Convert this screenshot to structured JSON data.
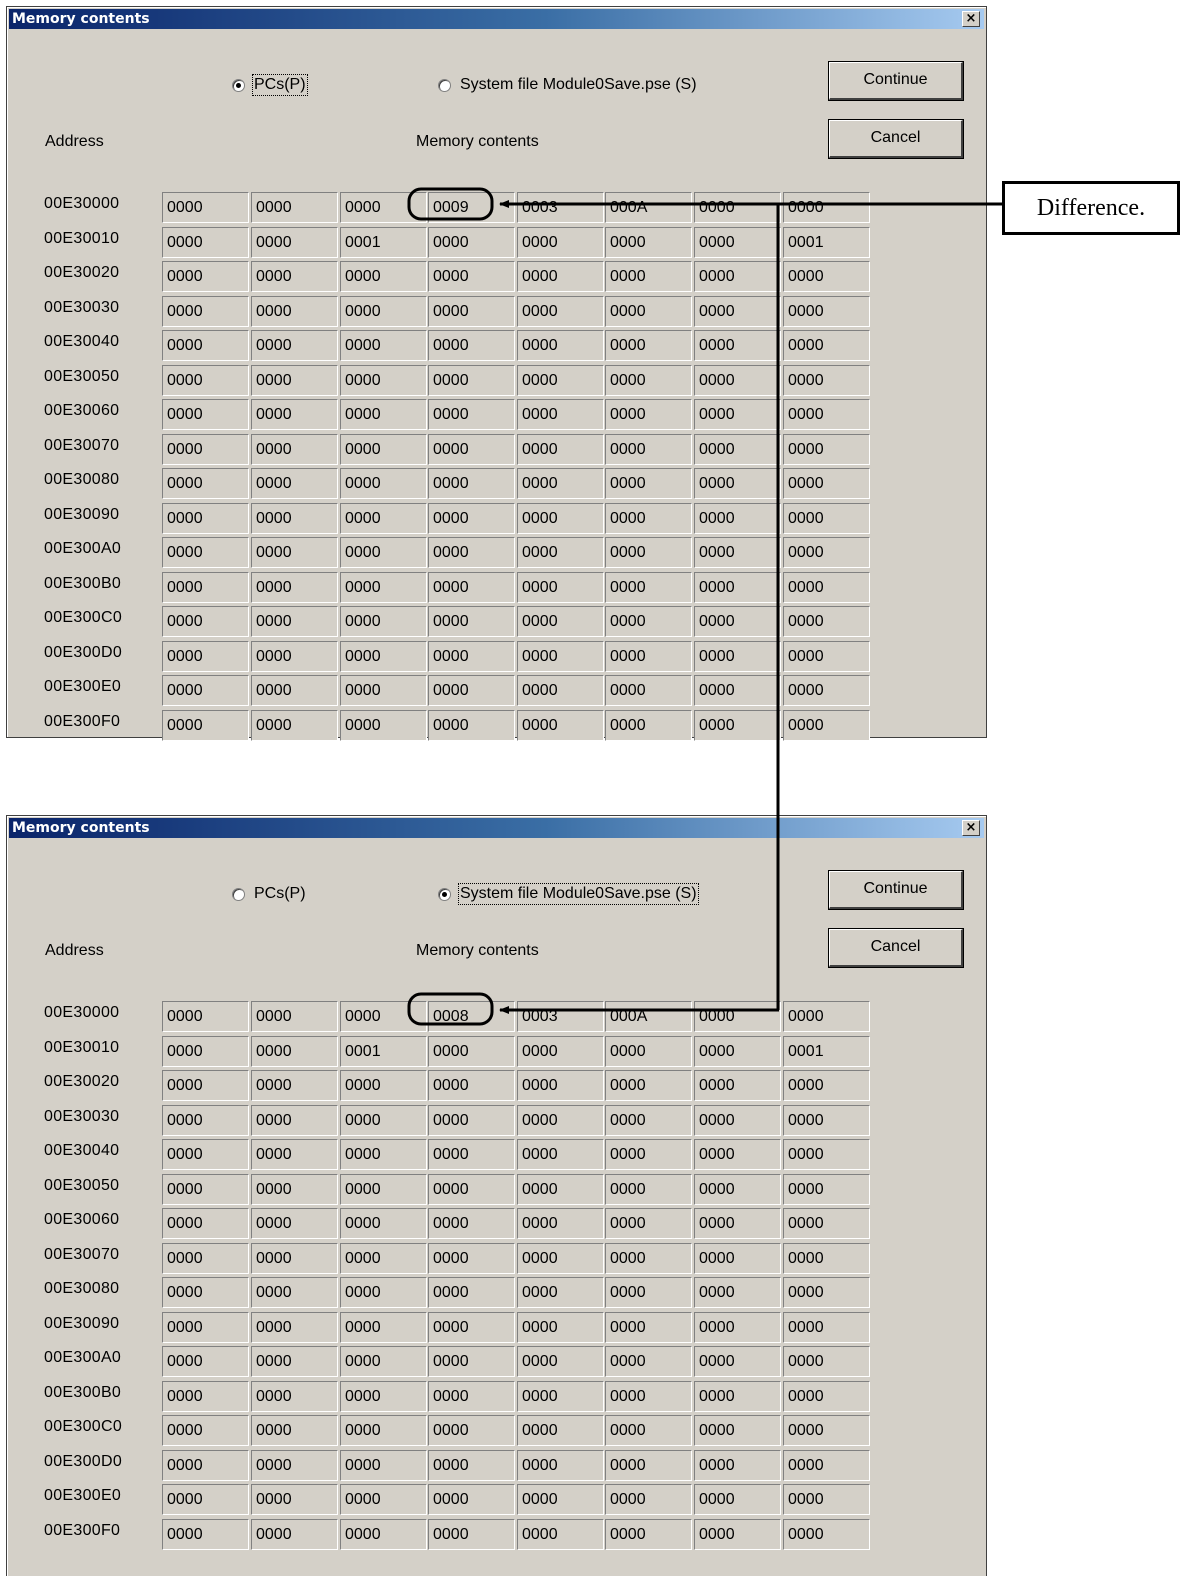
{
  "dialogs": [
    {
      "title": "Memory contents",
      "close_symbol": "×",
      "radio_pcs": "PCs(P)",
      "radio_system": "System file Module0Save.pse (S)",
      "selected": "pcs",
      "continue_label": "Continue",
      "cancel_label": "Cancel",
      "address_header": "Address",
      "memory_header": "Memory contents",
      "rows": [
        {
          "address": "00E30000",
          "cells": [
            "0000",
            "0000",
            "0000",
            "0009",
            "0003",
            "000A",
            "0000",
            "0000"
          ]
        },
        {
          "address": "00E30010",
          "cells": [
            "0000",
            "0000",
            "0001",
            "0000",
            "0000",
            "0000",
            "0000",
            "0001"
          ]
        },
        {
          "address": "00E30020",
          "cells": [
            "0000",
            "0000",
            "0000",
            "0000",
            "0000",
            "0000",
            "0000",
            "0000"
          ]
        },
        {
          "address": "00E30030",
          "cells": [
            "0000",
            "0000",
            "0000",
            "0000",
            "0000",
            "0000",
            "0000",
            "0000"
          ]
        },
        {
          "address": "00E30040",
          "cells": [
            "0000",
            "0000",
            "0000",
            "0000",
            "0000",
            "0000",
            "0000",
            "0000"
          ]
        },
        {
          "address": "00E30050",
          "cells": [
            "0000",
            "0000",
            "0000",
            "0000",
            "0000",
            "0000",
            "0000",
            "0000"
          ]
        },
        {
          "address": "00E30060",
          "cells": [
            "0000",
            "0000",
            "0000",
            "0000",
            "0000",
            "0000",
            "0000",
            "0000"
          ]
        },
        {
          "address": "00E30070",
          "cells": [
            "0000",
            "0000",
            "0000",
            "0000",
            "0000",
            "0000",
            "0000",
            "0000"
          ]
        },
        {
          "address": "00E30080",
          "cells": [
            "0000",
            "0000",
            "0000",
            "0000",
            "0000",
            "0000",
            "0000",
            "0000"
          ]
        },
        {
          "address": "00E30090",
          "cells": [
            "0000",
            "0000",
            "0000",
            "0000",
            "0000",
            "0000",
            "0000",
            "0000"
          ]
        },
        {
          "address": "00E300A0",
          "cells": [
            "0000",
            "0000",
            "0000",
            "0000",
            "0000",
            "0000",
            "0000",
            "0000"
          ]
        },
        {
          "address": "00E300B0",
          "cells": [
            "0000",
            "0000",
            "0000",
            "0000",
            "0000",
            "0000",
            "0000",
            "0000"
          ]
        },
        {
          "address": "00E300C0",
          "cells": [
            "0000",
            "0000",
            "0000",
            "0000",
            "0000",
            "0000",
            "0000",
            "0000"
          ]
        },
        {
          "address": "00E300D0",
          "cells": [
            "0000",
            "0000",
            "0000",
            "0000",
            "0000",
            "0000",
            "0000",
            "0000"
          ]
        },
        {
          "address": "00E300E0",
          "cells": [
            "0000",
            "0000",
            "0000",
            "0000",
            "0000",
            "0000",
            "0000",
            "0000"
          ]
        },
        {
          "address": "00E300F0",
          "cells": [
            "0000",
            "0000",
            "0000",
            "0000",
            "0000",
            "0000",
            "0000",
            "0000"
          ]
        }
      ]
    },
    {
      "title": "Memory contents",
      "close_symbol": "×",
      "radio_pcs": "PCs(P)",
      "radio_system": "System file Module0Save.pse (S)",
      "selected": "system",
      "continue_label": "Continue",
      "cancel_label": "Cancel",
      "address_header": "Address",
      "memory_header": "Memory contents",
      "rows": [
        {
          "address": "00E30000",
          "cells": [
            "0000",
            "0000",
            "0000",
            "0008",
            "0003",
            "000A",
            "0000",
            "0000"
          ]
        },
        {
          "address": "00E30010",
          "cells": [
            "0000",
            "0000",
            "0001",
            "0000",
            "0000",
            "0000",
            "0000",
            "0001"
          ]
        },
        {
          "address": "00E30020",
          "cells": [
            "0000",
            "0000",
            "0000",
            "0000",
            "0000",
            "0000",
            "0000",
            "0000"
          ]
        },
        {
          "address": "00E30030",
          "cells": [
            "0000",
            "0000",
            "0000",
            "0000",
            "0000",
            "0000",
            "0000",
            "0000"
          ]
        },
        {
          "address": "00E30040",
          "cells": [
            "0000",
            "0000",
            "0000",
            "0000",
            "0000",
            "0000",
            "0000",
            "0000"
          ]
        },
        {
          "address": "00E30050",
          "cells": [
            "0000",
            "0000",
            "0000",
            "0000",
            "0000",
            "0000",
            "0000",
            "0000"
          ]
        },
        {
          "address": "00E30060",
          "cells": [
            "0000",
            "0000",
            "0000",
            "0000",
            "0000",
            "0000",
            "0000",
            "0000"
          ]
        },
        {
          "address": "00E30070",
          "cells": [
            "0000",
            "0000",
            "0000",
            "0000",
            "0000",
            "0000",
            "0000",
            "0000"
          ]
        },
        {
          "address": "00E30080",
          "cells": [
            "0000",
            "0000",
            "0000",
            "0000",
            "0000",
            "0000",
            "0000",
            "0000"
          ]
        },
        {
          "address": "00E30090",
          "cells": [
            "0000",
            "0000",
            "0000",
            "0000",
            "0000",
            "0000",
            "0000",
            "0000"
          ]
        },
        {
          "address": "00E300A0",
          "cells": [
            "0000",
            "0000",
            "0000",
            "0000",
            "0000",
            "0000",
            "0000",
            "0000"
          ]
        },
        {
          "address": "00E300B0",
          "cells": [
            "0000",
            "0000",
            "0000",
            "0000",
            "0000",
            "0000",
            "0000",
            "0000"
          ]
        },
        {
          "address": "00E300C0",
          "cells": [
            "0000",
            "0000",
            "0000",
            "0000",
            "0000",
            "0000",
            "0000",
            "0000"
          ]
        },
        {
          "address": "00E300D0",
          "cells": [
            "0000",
            "0000",
            "0000",
            "0000",
            "0000",
            "0000",
            "0000",
            "0000"
          ]
        },
        {
          "address": "00E300E0",
          "cells": [
            "0000",
            "0000",
            "0000",
            "0000",
            "0000",
            "0000",
            "0000",
            "0000"
          ]
        },
        {
          "address": "00E300F0",
          "cells": [
            "0000",
            "0000",
            "0000",
            "0000",
            "0000",
            "0000",
            "0000",
            "0000"
          ]
        }
      ]
    }
  ],
  "annotation": {
    "text": "Difference."
  }
}
